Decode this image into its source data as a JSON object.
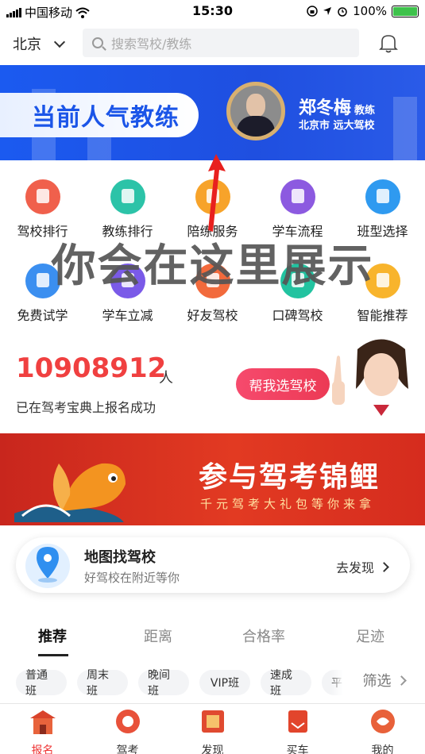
{
  "status_bar": {
    "carrier": "中国移动",
    "time": "15:30",
    "battery": "100%",
    "battery_level": 1.0
  },
  "header": {
    "city": "北京",
    "search_placeholder": "搜索驾校/教练"
  },
  "banner": {
    "title": "当前人气教练",
    "coach_name": "郑冬梅",
    "coach_role": "教练",
    "coach_org": "北京市 远大驾校"
  },
  "grid": {
    "items": [
      {
        "label": "驾校排行",
        "color": "#f0604c"
      },
      {
        "label": "教练排行",
        "color": "#2cc3a8"
      },
      {
        "label": "陪练服务",
        "color": "#f7a32a"
      },
      {
        "label": "学车流程",
        "color": "#8c5ae0"
      },
      {
        "label": "班型选择",
        "color": "#2f9af0"
      },
      {
        "label": "免费试学",
        "color": "#3b8ff0"
      },
      {
        "label": "学车立减",
        "color": "#7a5ae8"
      },
      {
        "label": "好友驾校",
        "color": "#f26a3c"
      },
      {
        "label": "口碑驾校",
        "color": "#22c3a0"
      },
      {
        "label": "智能推荐",
        "color": "#f8b42c"
      }
    ]
  },
  "overlay_text": "你会在这里展示",
  "counter": {
    "number": "10908912",
    "unit": "人",
    "subtitle": "已在驾考宝典上报名成功",
    "button": "帮我选驾校"
  },
  "koi_banner": {
    "title": "参与驾考锦鲤",
    "subtitle": "千元驾考大礼包等你来拿"
  },
  "map_card": {
    "title": "地图找驾校",
    "subtitle": "好驾校在附近等你",
    "action": "去发现"
  },
  "tabs": [
    {
      "label": "推荐",
      "active": true
    },
    {
      "label": "距离",
      "active": false
    },
    {
      "label": "合格率",
      "active": false
    },
    {
      "label": "足迹",
      "active": false
    }
  ],
  "chips": [
    "普通班",
    "周末班",
    "晚间班",
    "VIP班",
    "速成班",
    "平"
  ],
  "filter": {
    "label": "筛选"
  },
  "bottom_nav": [
    {
      "label": "报名",
      "active": true,
      "icon": "signup-icon"
    },
    {
      "label": "驾考",
      "active": false,
      "icon": "exam-icon"
    },
    {
      "label": "发现",
      "active": false,
      "icon": "discover-icon"
    },
    {
      "label": "买车",
      "active": false,
      "icon": "buy-car-icon"
    },
    {
      "label": "我的",
      "active": false,
      "icon": "profile-icon"
    }
  ]
}
